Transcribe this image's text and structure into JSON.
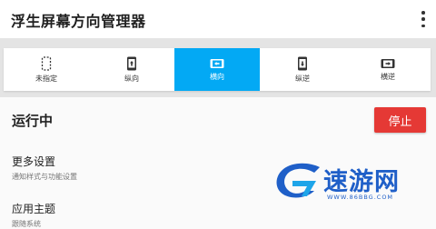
{
  "app": {
    "title": "浮生屏幕方向管理器"
  },
  "orientation_options": [
    {
      "label": "未指定",
      "icon": "unspecified-phone-icon",
      "active": false
    },
    {
      "label": "纵向",
      "icon": "portrait-phone-icon",
      "active": false
    },
    {
      "label": "横向",
      "icon": "landscape-phone-icon",
      "active": true
    },
    {
      "label": "纵逆",
      "icon": "reverse-portrait-phone-icon",
      "active": false
    },
    {
      "label": "横逆",
      "icon": "reverse-landscape-phone-icon",
      "active": false
    }
  ],
  "status": {
    "label": "运行中",
    "stop_label": "停止"
  },
  "settings": [
    {
      "title": "更多设置",
      "subtitle": "通知样式与功能设置"
    },
    {
      "title": "应用主题",
      "subtitle": "跟随系统"
    }
  ],
  "watermark": {
    "text": "速游网",
    "url": "WWW.86BBG.COM",
    "color": "#1f5fc8"
  },
  "colors": {
    "accent": "#03a9f4",
    "stop": "#e53935"
  }
}
